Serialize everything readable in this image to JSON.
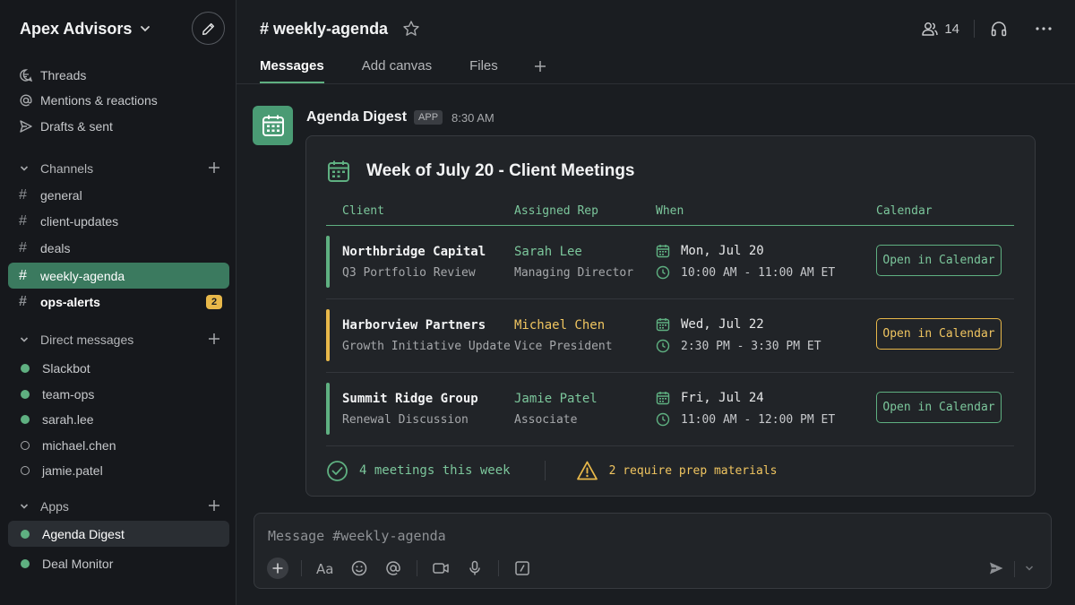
{
  "workspace": {
    "name": "Apex Advisors"
  },
  "sidebar": {
    "nav": [
      {
        "label": "Threads",
        "icon": "threads-icon"
      },
      {
        "label": "Mentions & reactions",
        "icon": "at-icon"
      },
      {
        "label": "Drafts & sent",
        "icon": "send-icon"
      }
    ],
    "channels_label": "Channels",
    "channels": [
      {
        "name": "general"
      },
      {
        "name": "client-updates"
      },
      {
        "name": "deals"
      },
      {
        "name": "weekly-agenda",
        "active": true
      },
      {
        "name": "ops-alerts",
        "unread": true,
        "badge": "2"
      }
    ],
    "dms_label": "Direct messages",
    "dms": [
      {
        "name": "Slackbot",
        "online": true
      },
      {
        "name": "team-ops",
        "online": true
      },
      {
        "name": "sarah.lee",
        "online": true
      },
      {
        "name": "michael.chen",
        "online": false
      },
      {
        "name": "jamie.patel",
        "online": false
      }
    ],
    "apps_label": "Apps",
    "apps": [
      {
        "name": "Agenda Digest",
        "active": true,
        "online": true
      },
      {
        "name": "Deal Monitor",
        "online": true
      }
    ]
  },
  "header": {
    "channel_name": "# weekly-agenda",
    "member_count": "14",
    "tabs": [
      "Messages",
      "Add canvas",
      "Files"
    ]
  },
  "message": {
    "sender": "Agenda Digest",
    "tag": "APP",
    "time": "8:30 AM",
    "card": {
      "title": "Week of July 20 - Client Meetings",
      "columns": [
        "Client",
        "Assigned Rep",
        "When",
        "Calendar"
      ],
      "rows": [
        {
          "client": "Northbridge Capital",
          "project": "Q3 Portfolio Review",
          "rep": "Sarah Lee",
          "role": "Managing Director",
          "date": "Mon, Jul 20",
          "time": "10:00 AM - 11:00 AM ET",
          "button": "Open in Calendar",
          "accent": "#5fb081"
        },
        {
          "client": "Harborview Partners",
          "project": "Growth Initiative Update",
          "rep": "Michael Chen",
          "role": "Vice President",
          "date": "Wed, Jul 22",
          "time": "2:30 PM - 3:30 PM ET",
          "button": "Open in Calendar",
          "accent": "#e8b84a"
        },
        {
          "client": "Summit Ridge Group",
          "project": "Renewal Discussion",
          "rep": "Jamie Patel",
          "role": "Associate",
          "date": "Fri, Jul 24",
          "time": "11:00 AM - 12:00 PM ET",
          "button": "Open in Calendar",
          "accent": "#5fb081"
        }
      ],
      "summary": "4 meetings this week",
      "warning": "2 require prep materials"
    }
  },
  "composer": {
    "placeholder": "Message #weekly-agenda"
  },
  "colors": {
    "accent_green": "#5fb081",
    "accent_amber": "#e8b84a",
    "active_channel": "#3b7a5f"
  }
}
